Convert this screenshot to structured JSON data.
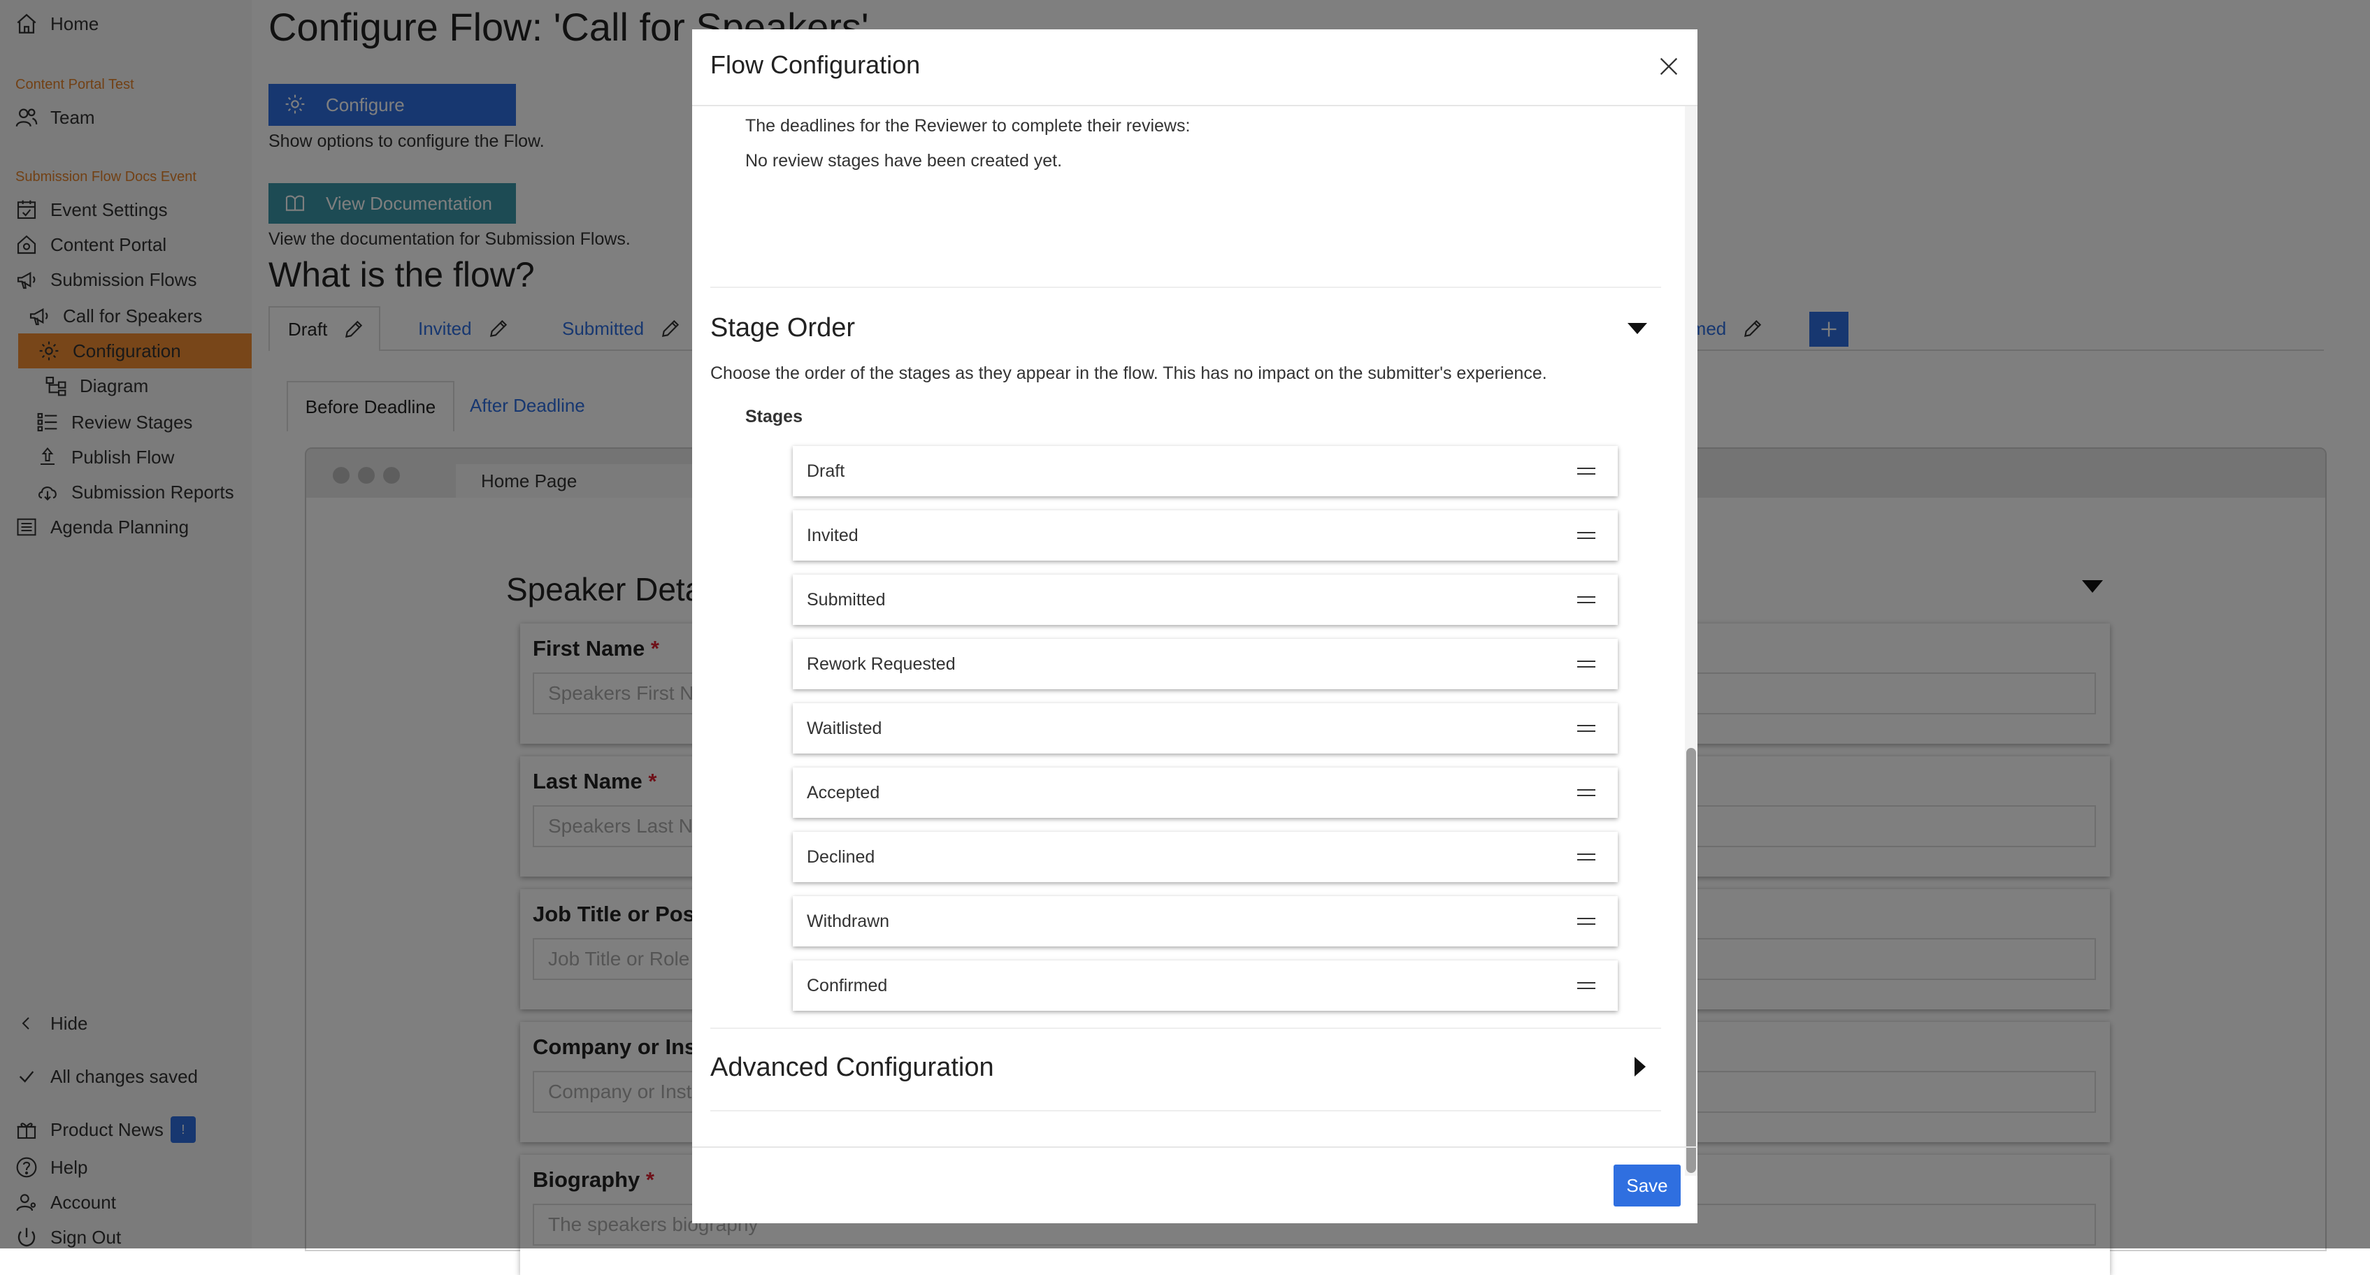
{
  "sidebar": {
    "home": "Home",
    "org_section": "Content Portal Test",
    "team": "Team",
    "event_section": "Submission Flow Docs Event",
    "items": [
      {
        "label": "Event Settings"
      },
      {
        "label": "Content Portal"
      },
      {
        "label": "Submission Flows"
      },
      {
        "label": "Call for Speakers"
      },
      {
        "label": "Configuration",
        "active": true
      },
      {
        "label": "Diagram"
      },
      {
        "label": "Review Stages"
      },
      {
        "label": "Publish Flow"
      },
      {
        "label": "Submission Reports"
      },
      {
        "label": "Agenda Planning"
      }
    ],
    "hide": "Hide",
    "saved_status": "All changes saved",
    "product_news": "Product News",
    "product_news_badge": "!",
    "help": "Help",
    "account": "Account",
    "sign_out": "Sign Out"
  },
  "main": {
    "title": "Configure Flow: 'Call for Speakers'",
    "configure_button": "Configure",
    "configure_help": "Show options to configure the Flow.",
    "documentation_button": "View Documentation",
    "documentation_help": "View the documentation for Submission Flows.",
    "flow_heading": "What is the flow?",
    "stage_tabs": [
      "Draft",
      "Invited",
      "Submitted",
      "rmed"
    ],
    "deadline_tabs": [
      "Before Deadline",
      "After Deadline"
    ],
    "preview_tab": "Home Page",
    "form_title": "Speaker Deta",
    "fields": [
      {
        "label": "First Name",
        "required": "*",
        "placeholder": "Speakers First N"
      },
      {
        "label": "Last Name",
        "required": "*",
        "placeholder": "Speakers Last N"
      },
      {
        "label": "Job Title or Posi",
        "required": "",
        "placeholder": "Job Title or Role"
      },
      {
        "label": "Company or Inst",
        "required": "",
        "placeholder": "Company or Inst"
      },
      {
        "label": "Biography",
        "required": "*",
        "placeholder": "The speakers biography"
      }
    ]
  },
  "modal": {
    "title": "Flow Configuration",
    "deadlines_text": "The deadlines for the Reviewer to complete their reviews:",
    "no_review_text": "No review stages have been created yet.",
    "stage_order_heading": "Stage Order",
    "stage_order_desc": "Choose the order of the stages as they appear in the flow. This has no impact on the submitter's experience.",
    "stages_label": "Stages",
    "stages": [
      "Draft",
      "Invited",
      "Submitted",
      "Rework Requested",
      "Waitlisted",
      "Accepted",
      "Declined",
      "Withdrawn",
      "Confirmed"
    ],
    "advanced_heading": "Advanced Configuration",
    "save_button": "Save"
  },
  "icons": {
    "home": "home-icon",
    "team": "team-icon",
    "event_settings": "calendar-icon",
    "content_portal": "portal-icon",
    "submission_flows": "megaphone-icon",
    "configuration": "gear-icon",
    "diagram": "diagram-icon",
    "review_stages": "list-icon",
    "publish_flow": "publish-icon",
    "reports": "cloud-download-icon",
    "agenda": "agenda-icon"
  },
  "colors": {
    "accent": "#2f6fe0",
    "sidebar_active": "#f08c33",
    "section_label": "#e4822b",
    "doc_button": "#3b97a8"
  }
}
